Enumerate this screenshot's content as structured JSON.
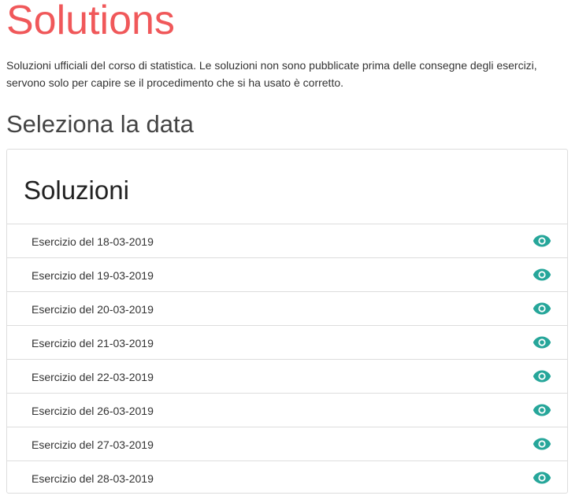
{
  "page": {
    "title": "Solutions",
    "intro": "Soluzioni ufficiali del corso di statistica. Le soluzioni non sono pubblicate prima delle consegne degli esercizi, servono solo per capire se il procedimento che si ha usato è corretto.",
    "section_heading": "Seleziona la data"
  },
  "card": {
    "title": "Soluzioni",
    "items": [
      {
        "label": "Esercizio del 18-03-2019",
        "icon": "eye-icon"
      },
      {
        "label": "Esercizio del 19-03-2019",
        "icon": "eye-icon"
      },
      {
        "label": "Esercizio del 20-03-2019",
        "icon": "eye-icon"
      },
      {
        "label": "Esercizio del 21-03-2019",
        "icon": "eye-icon"
      },
      {
        "label": "Esercizio del 22-03-2019",
        "icon": "eye-icon"
      },
      {
        "label": "Esercizio del 26-03-2019",
        "icon": "eye-icon"
      },
      {
        "label": "Esercizio del 27-03-2019",
        "icon": "eye-icon"
      },
      {
        "label": "Esercizio del 28-03-2019",
        "icon": "eye-icon"
      }
    ]
  },
  "colors": {
    "title": "#f0585a",
    "icon": "#26a69a",
    "border": "#dddddd"
  }
}
